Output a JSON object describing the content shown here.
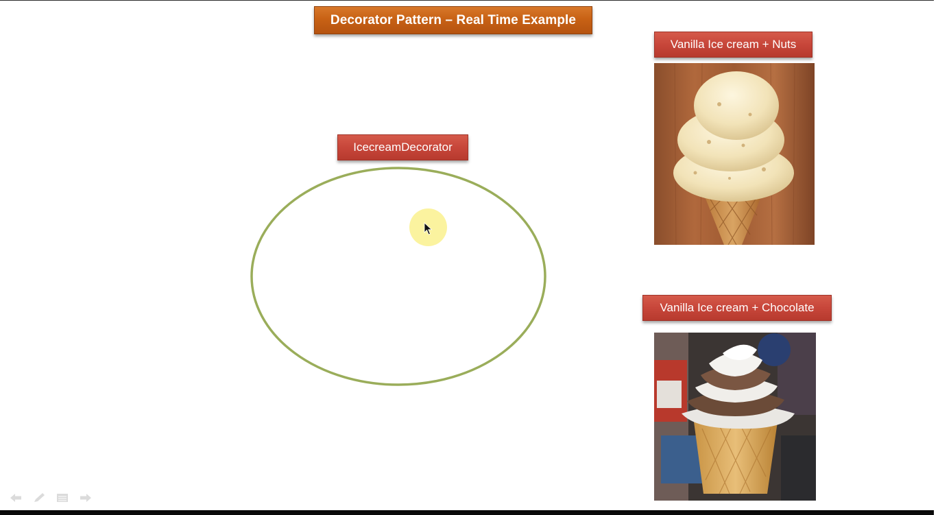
{
  "slide": {
    "title": "Decorator Pattern – Real Time Example",
    "decorator_label": "IcecreamDecorator",
    "examples": [
      {
        "label": "Vanilla Ice cream + Nuts",
        "image": "vanilla-nuts-cone-photo"
      },
      {
        "label": "Vanilla Ice cream + Chocolate",
        "image": "vanilla-chocolate-swirl-photo"
      }
    ]
  },
  "colors": {
    "title_fill": "#c86215",
    "label_fill": "#c7463a",
    "ellipse_stroke": "#9aad5a",
    "cursor_highlight": "#fbf29a"
  },
  "icons": {
    "cursor": "mouse-pointer-icon",
    "nav": [
      "previous-slide-icon",
      "pen-icon",
      "slide-menu-icon",
      "next-slide-icon"
    ]
  }
}
